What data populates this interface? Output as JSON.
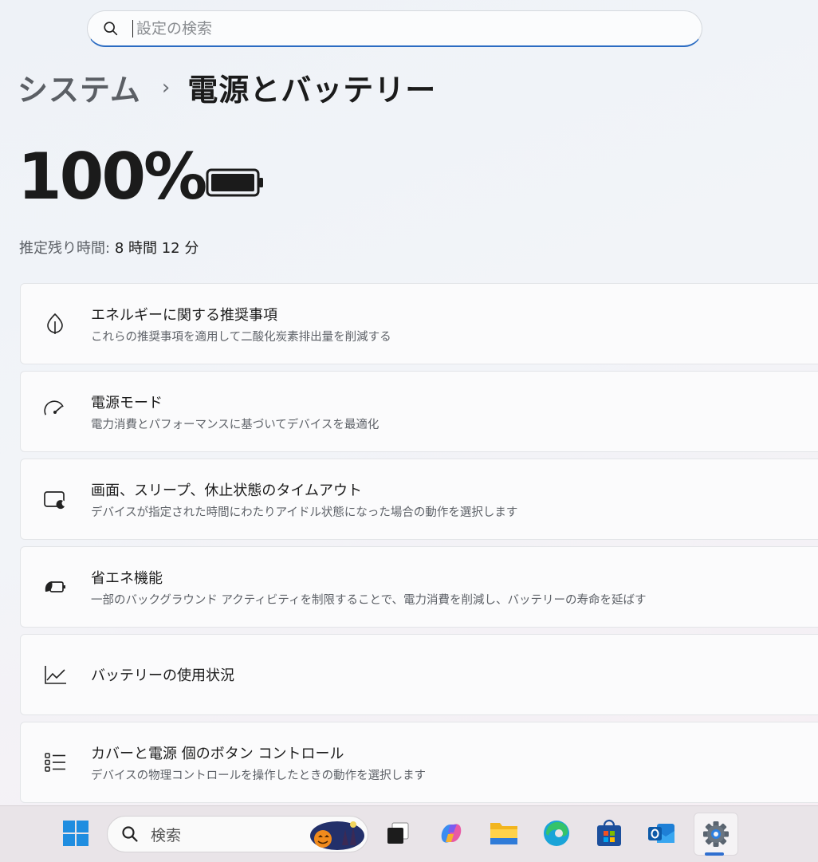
{
  "search": {
    "placeholder": "設定の検索",
    "icon": "search-icon"
  },
  "breadcrumb": {
    "parent": "システム",
    "separator": "›",
    "current": "電源とバッテリー"
  },
  "battery": {
    "percent": "100%",
    "level": 1.0,
    "remaining_label": "推定残り時間:",
    "remaining_value": "8 時間 12 分"
  },
  "cards": [
    {
      "title": "エネルギーに関する推奨事項",
      "desc": "これらの推奨事項を適用して二酸化炭素排出量を削減する",
      "icon": "leaf-icon"
    },
    {
      "title": "電源モード",
      "desc": "電力消費とパフォーマンスに基づいてデバイスを最適化",
      "icon": "speedometer-icon"
    },
    {
      "title": "画面、スリープ、休止状態のタイムアウト",
      "desc": "デバイスが指定された時間にわたりアイドル状態になった場合の動作を選択します",
      "icon": "screen-sleep-icon"
    },
    {
      "title": "省エネ機能",
      "desc": "一部のバックグラウンド アクティビティを制限することで、電力消費を削減し、バッテリーの寿命を延ばす",
      "icon": "energy-saver-icon"
    },
    {
      "title": "バッテリーの使用状況",
      "desc": "",
      "icon": "line-chart-icon"
    },
    {
      "title": "カバーと電源 個のボタン コントロール",
      "desc": "デバイスの物理コントロールを操作したときの動作を選択します",
      "icon": "list-icon"
    }
  ],
  "taskbar": {
    "search_label": "検索",
    "items": [
      "start-icon",
      "search-icon",
      "task-view-icon",
      "copilot-icon",
      "file-explorer-icon",
      "edge-icon",
      "store-icon",
      "outlook-icon",
      "settings-icon"
    ],
    "accent": "#2f6fd0"
  },
  "colors": {
    "accent": "#2a6bc2",
    "text": "#1b1b1b",
    "secondary": "#5e6268"
  }
}
